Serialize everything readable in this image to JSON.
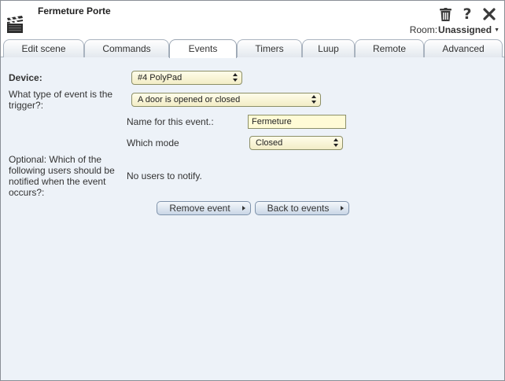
{
  "header": {
    "title": "Fermeture Porte",
    "room_label": "Room:",
    "room_value": "Unassigned"
  },
  "icons": {
    "scene": "clapperboard-icon",
    "delete": "trash-icon",
    "help": "help-icon",
    "close": "close-icon"
  },
  "tabs": [
    {
      "label": "Edit scene"
    },
    {
      "label": "Commands"
    },
    {
      "label": "Events"
    },
    {
      "label": "Timers"
    },
    {
      "label": "Luup"
    },
    {
      "label": "Remote"
    },
    {
      "label": "Advanced"
    }
  ],
  "active_tab": "Events",
  "form": {
    "device_label": "Device:",
    "device_value": "#4 PolyPad",
    "trigger_label": "What type of event is the trigger?:",
    "trigger_value": "A door is opened or closed",
    "name_label": "Name for this event.:",
    "name_value": "Fermeture",
    "mode_label": "Which mode",
    "mode_value": "Closed",
    "users_label": "Optional: Which of the following users should be notified when the event occurs?:",
    "users_value": "No users to notify."
  },
  "buttons": {
    "remove": "Remove event",
    "back": "Back to events"
  },
  "colors": {
    "select_bg": "#fffde9",
    "field_bg": "#fffbd6",
    "panel_bg": "#edf2f8"
  }
}
